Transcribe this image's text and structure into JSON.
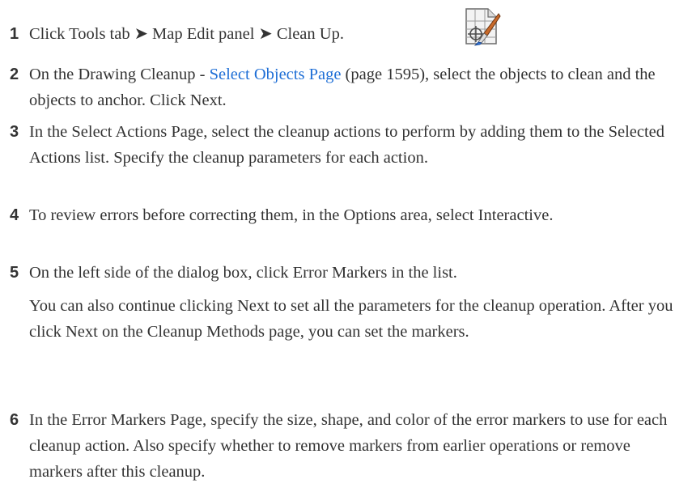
{
  "steps": [
    {
      "number": "1",
      "text": "Click Tools tab ➤ Map Edit panel ➤ Clean Up.",
      "icon": "cleanup-tool-icon"
    },
    {
      "number": "2",
      "text_before": "On the Drawing Cleanup - ",
      "link": "Select Objects Page",
      "text_after": " (page 1595), select the objects to clean and the objects to anchor. Click Next."
    },
    {
      "number": "3",
      "text": "In the Select Actions Page, select the cleanup actions to perform by adding them to the Selected Actions list. Specify the cleanup parameters for each action."
    },
    {
      "number": "4",
      "text": "To review errors before correcting them, in the Options area, select Interactive."
    },
    {
      "number": "5",
      "text": "On the left side of the dialog box, click Error Markers in the list.",
      "extra": "You can also continue clicking Next to set all the parameters for the cleanup operation. After you click Next on the Cleanup Methods page, you can set the markers."
    },
    {
      "number": "6",
      "text": "In the Error Markers Page, specify the size, shape, and color of the error markers to use for each cleanup action. Also specify whether to remove markers from earlier operations or remove markers after this cleanup."
    }
  ],
  "colors": {
    "text": "#333333",
    "link": "#1f6fd6"
  }
}
